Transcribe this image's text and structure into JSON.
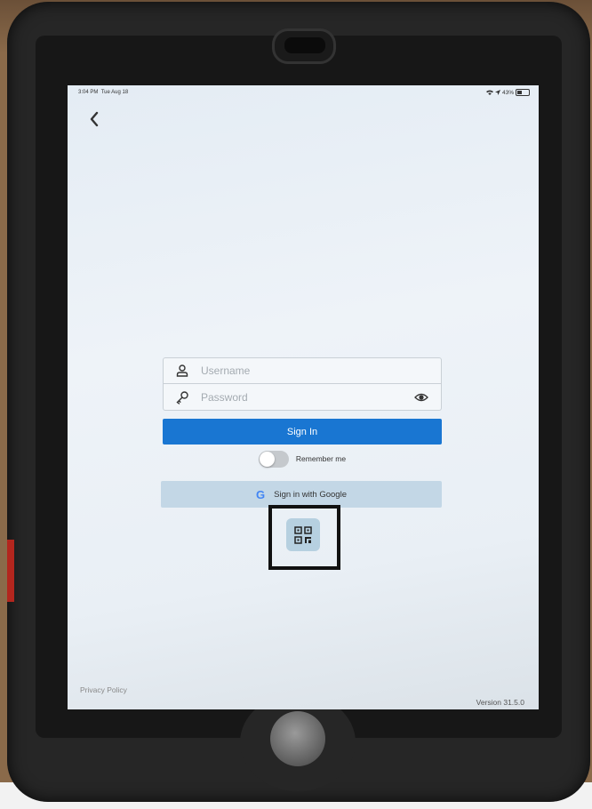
{
  "status_bar": {
    "time": "3:04 PM",
    "date": "Tue Aug 18",
    "battery": "43%",
    "battery_level": 0.43
  },
  "login": {
    "username_placeholder": "Username",
    "password_placeholder": "Password",
    "signin_label": "Sign In",
    "remember_label": "Remember me",
    "remember_checked": false,
    "google_label": "Sign in with Google",
    "google_glyph": "G"
  },
  "footer": {
    "privacy": "Privacy Policy",
    "version": "Version 31.5.0"
  },
  "colors": {
    "primary": "#1976d2",
    "google_button": "#c3d7e6",
    "qr_button": "#b6d0e0",
    "highlight_frame": "#111111"
  },
  "icons": [
    "back-chevron-icon",
    "user-icon",
    "key-icon",
    "eye-icon",
    "google-icon",
    "qr-code-icon",
    "wifi-icon",
    "location-icon",
    "battery-icon"
  ]
}
